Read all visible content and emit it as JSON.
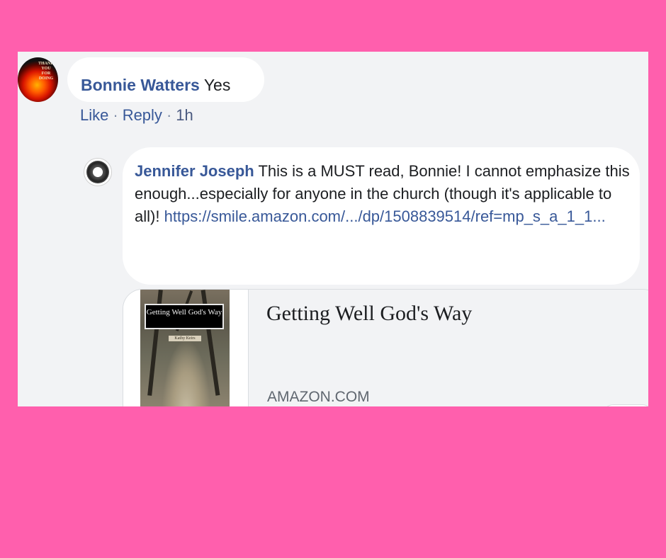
{
  "comments": [
    {
      "author": "Bonnie Watters",
      "text": "Yes",
      "actions": {
        "like": "Like",
        "separator": "·",
        "reply": "Reply",
        "time": "1h"
      },
      "avatar_text": "THANK YOU FOR DOING"
    },
    {
      "author": "Jennifer Joseph",
      "text": "This is a MUST read, Bonnie! I cannot emphasize this enough...especially for anyone in the church (though it's applicable to all)!",
      "link": "https://smile.amazon.com/.../dp/1508839514/ref=mp_s_a_1_1...",
      "preview": {
        "title": "Getting Well God's Way",
        "source": "AMAZON.COM",
        "book_cover_title": "Getting Well God's Way",
        "book_cover_author": "Kathy Keirs"
      }
    }
  ],
  "colors": {
    "page_background": "#ff5fad",
    "panel_background": "#f2f3f5",
    "author_link": "#385898"
  }
}
